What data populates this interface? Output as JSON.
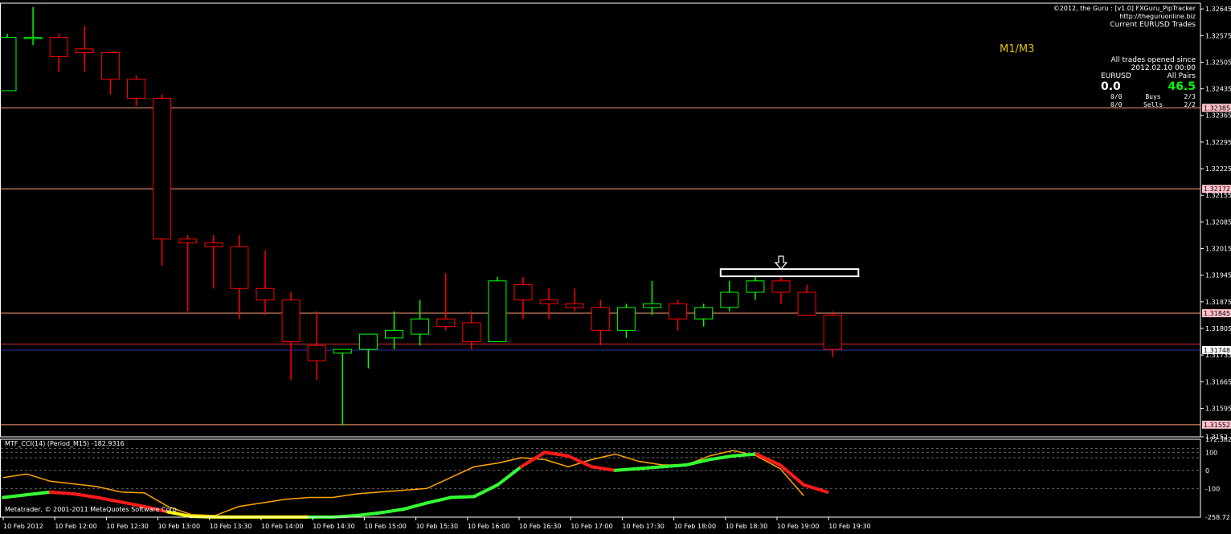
{
  "header": {
    "copyright": "©2012, the Guru : [v1.0] FXGuru_PipTracker",
    "url": "http://theguruonline.biz",
    "trades_title": "Current EURUSD Trades",
    "timeframe_label": "M1/M3"
  },
  "stats": {
    "opened_since_label": "All trades opened since",
    "opened_since_date": "2012.02.10 00:00",
    "col1_label": "EURUSD",
    "col2_label": "All Pairs",
    "col1_value": "0.0",
    "col2_value": "46.5",
    "row1_left": "0/0",
    "row1_mid": "Buys",
    "row1_right": "2/3",
    "row2_left": "0/0",
    "row2_mid": "Sells",
    "row2_right": "2/2"
  },
  "colors": {
    "bull": "#00ff00",
    "bear": "#ff0000",
    "hline": "#ffa07a",
    "cci_orange": "#ffa500",
    "cci_green": "#33ff33",
    "cci_red": "#ff1a1a",
    "grid": "#888888",
    "box": "#ffffff",
    "label_bg": "#ffc0cb"
  },
  "chart_data": [
    {
      "type": "candlestick",
      "symbol": "EURUSD",
      "period": "M15",
      "ylim": [
        1.3152,
        1.3266
      ],
      "y_ticks": [
        "1.32645",
        "1.32575",
        "1.32505",
        "1.32435",
        "1.32365",
        "1.32295",
        "1.32225",
        "1.32155",
        "1.32085",
        "1.32015",
        "1.31945",
        "1.31875",
        "1.31805",
        "1.31735",
        "1.31665",
        "1.31595",
        "1.3152"
      ],
      "x_labels": [
        "10 Feb 2012",
        "10 Feb 12:00",
        "10 Feb 12:30",
        "10 Feb 13:00",
        "10 Feb 13:30",
        "10 Feb 14:00",
        "10 Feb 14:30",
        "10 Feb 15:00",
        "10 Feb 15:30",
        "10 Feb 16:00",
        "10 Feb 16:30",
        "10 Feb 17:00",
        "10 Feb 17:30",
        "10 Feb 18:00",
        "10 Feb 18:30",
        "10 Feb 19:00",
        "10 Feb 19:30"
      ],
      "candles": [
        {
          "o": 1.3243,
          "h": 1.3258,
          "l": 1.3243,
          "c": 1.3257
        },
        {
          "o": 1.3257,
          "h": 1.3265,
          "l": 1.3255,
          "c": 1.3257
        },
        {
          "o": 1.3257,
          "h": 1.3258,
          "l": 1.3248,
          "c": 1.3252
        },
        {
          "o": 1.3254,
          "h": 1.326,
          "l": 1.3248,
          "c": 1.3253
        },
        {
          "o": 1.3253,
          "h": 1.3253,
          "l": 1.3242,
          "c": 1.3246
        },
        {
          "o": 1.3246,
          "h": 1.3247,
          "l": 1.3239,
          "c": 1.3241
        },
        {
          "o": 1.3241,
          "h": 1.3242,
          "l": 1.3197,
          "c": 1.3204
        },
        {
          "o": 1.3204,
          "h": 1.3205,
          "l": 1.3185,
          "c": 1.3203
        },
        {
          "o": 1.3203,
          "h": 1.3205,
          "l": 1.3191,
          "c": 1.3202
        },
        {
          "o": 1.3202,
          "h": 1.3205,
          "l": 1.3183,
          "c": 1.3191
        },
        {
          "o": 1.3191,
          "h": 1.3201,
          "l": 1.3184,
          "c": 1.3188
        },
        {
          "o": 1.3188,
          "h": 1.319,
          "l": 1.3167,
          "c": 1.3177
        },
        {
          "o": 1.3176,
          "h": 1.3185,
          "l": 1.3167,
          "c": 1.3172
        },
        {
          "o": 1.3174,
          "h": 1.3175,
          "l": 1.3155,
          "c": 1.3175
        },
        {
          "o": 1.3175,
          "h": 1.3179,
          "l": 1.317,
          "c": 1.3179
        },
        {
          "o": 1.3178,
          "h": 1.3185,
          "l": 1.3175,
          "c": 1.318
        },
        {
          "o": 1.3179,
          "h": 1.3188,
          "l": 1.3176,
          "c": 1.3183
        },
        {
          "o": 1.3183,
          "h": 1.3195,
          "l": 1.318,
          "c": 1.3181
        },
        {
          "o": 1.3182,
          "h": 1.3185,
          "l": 1.3175,
          "c": 1.3177
        },
        {
          "o": 1.3177,
          "h": 1.3194,
          "l": 1.3177,
          "c": 1.3193
        },
        {
          "o": 1.3192,
          "h": 1.3194,
          "l": 1.3183,
          "c": 1.3188
        },
        {
          "o": 1.3188,
          "h": 1.3191,
          "l": 1.3183,
          "c": 1.3187
        },
        {
          "o": 1.3187,
          "h": 1.3191,
          "l": 1.3185,
          "c": 1.3186
        },
        {
          "o": 1.3186,
          "h": 1.3188,
          "l": 1.3176,
          "c": 1.318
        },
        {
          "o": 1.318,
          "h": 1.3187,
          "l": 1.3178,
          "c": 1.3186
        },
        {
          "o": 1.3186,
          "h": 1.3193,
          "l": 1.3184,
          "c": 1.3187
        },
        {
          "o": 1.3187,
          "h": 1.3188,
          "l": 1.318,
          "c": 1.3183
        },
        {
          "o": 1.3183,
          "h": 1.3187,
          "l": 1.3181,
          "c": 1.3186
        },
        {
          "o": 1.3186,
          "h": 1.3193,
          "l": 1.3185,
          "c": 1.319
        },
        {
          "o": 1.319,
          "h": 1.3194,
          "l": 1.3188,
          "c": 1.3193
        },
        {
          "o": 1.3193,
          "h": 1.3194,
          "l": 1.3187,
          "c": 1.319
        },
        {
          "o": 1.319,
          "h": 1.3192,
          "l": 1.3184,
          "c": 1.3184
        },
        {
          "o": 1.3184,
          "h": 1.3185,
          "l": 1.3173,
          "c": 1.3175
        }
      ],
      "hlines": [
        {
          "value": 1.32385,
          "label": "1.32385",
          "style": "salmon"
        },
        {
          "value": 1.32172,
          "label": "1.32172",
          "style": "salmon"
        },
        {
          "value": 1.31845,
          "label": "1.31845",
          "style": "salmon"
        },
        {
          "value": 1.31764,
          "label": "",
          "style": "red"
        },
        {
          "value": 1.31748,
          "label": "1.31748",
          "style": "blue"
        },
        {
          "value": 1.31552,
          "label": "1.31552",
          "style": "salmon"
        }
      ],
      "arrow_candle_index": 30,
      "box": {
        "from_index": 28,
        "to_index": 33,
        "y_top": 1.31961,
        "y_bottom": 1.3195
      }
    },
    {
      "type": "line",
      "title": "MTF_CCI(14) (Period_M15) -182.9316",
      "ylim": [
        -258.72,
        172.382
      ],
      "y_ticks": [
        "172.382",
        "100",
        "0",
        "-100",
        "-258.72"
      ],
      "grid_levels": [
        100,
        0,
        -100,
        -258.72,
        120,
        70
      ],
      "series": [
        {
          "style": "orange",
          "values": [
            -40,
            -20,
            -60,
            -75,
            -90,
            -120,
            -125,
            -200,
            -245,
            -250,
            -200,
            -180,
            -160,
            -150,
            -150,
            -130,
            -120,
            -110,
            -100,
            -40,
            20,
            40,
            70,
            60,
            20,
            60,
            90,
            50,
            30,
            30,
            80,
            110,
            80,
            10,
            -140
          ]
        },
        {
          "style": "cci",
          "values": [
            -150,
            -135,
            -120,
            -130,
            -150,
            -175,
            -200,
            -230,
            -255,
            -258,
            -258,
            -258,
            -258,
            -258,
            -258,
            -250,
            -235,
            -215,
            -180,
            -150,
            -145,
            -80,
            20,
            100,
            80,
            20,
            0,
            10,
            20,
            30,
            60,
            80,
            90,
            30,
            -80,
            -120
          ]
        }
      ],
      "cci_colors": [
        "green",
        "green",
        "red",
        "red",
        "red",
        "red",
        "red",
        "yellow",
        "yellow",
        "yellow",
        "yellow",
        "yellow",
        "yellow",
        "green",
        "green",
        "green",
        "green",
        "green",
        "green",
        "green",
        "green",
        "green",
        "red",
        "red",
        "red",
        "red",
        "green",
        "green",
        "green",
        "green",
        "green",
        "green",
        "red",
        "red",
        "red",
        "red"
      ]
    }
  ],
  "footer": {
    "copyright": "Metatrader, © 2001-2011 MetaQuotes Software Corp."
  }
}
